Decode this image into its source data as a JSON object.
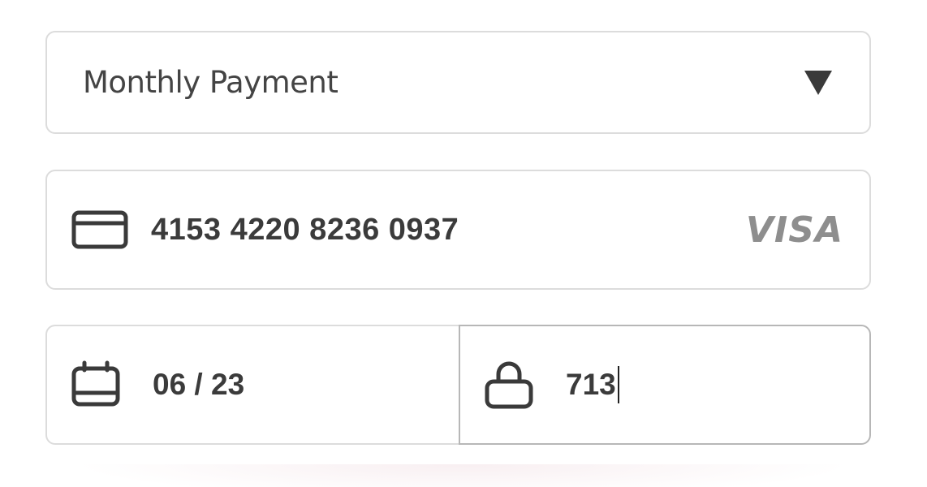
{
  "plan_select": {
    "selected_value": "Monthly Payment",
    "icon": "triangle-down-icon"
  },
  "card": {
    "number": "4153 4220 8236 0937",
    "brand": "VISA",
    "icon": "credit-card-icon"
  },
  "expiry": {
    "value": "06 / 23",
    "icon": "calendar-icon"
  },
  "cvc": {
    "value": "713",
    "icon": "lock-icon"
  },
  "colors": {
    "text": "#3b3b3b",
    "border": "#dcdcdc",
    "border_focus": "#b7b7b7",
    "brand_logo": "#8e8e8e"
  }
}
